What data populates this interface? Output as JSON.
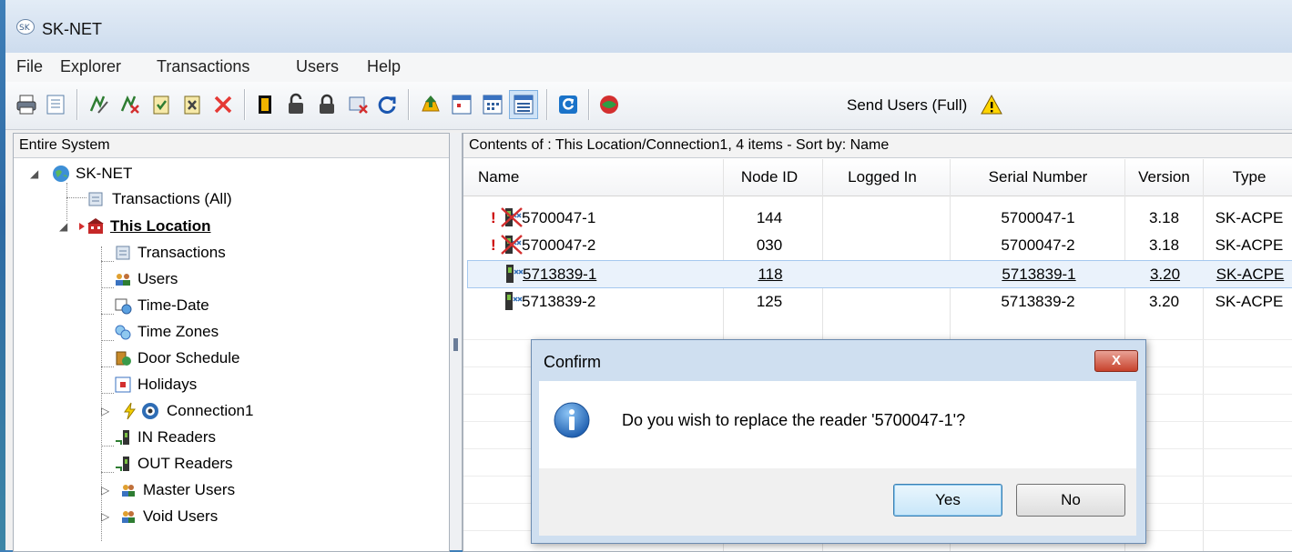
{
  "app": {
    "title": "SK-NET"
  },
  "menu": [
    "File",
    "Explorer",
    "Transactions",
    "Users",
    "Help"
  ],
  "toolbar": {
    "send_users_label": "Send Users (Full)"
  },
  "left_pane": {
    "header": "Entire System",
    "tree": {
      "root": "SK-NET",
      "transactions_all": "Transactions (All)",
      "location": "This Location",
      "items": [
        "Transactions",
        "Users",
        "Time-Date",
        "Time Zones",
        "Door Schedule",
        "Holidays",
        "Connection1",
        "IN Readers",
        "OUT Readers",
        "Master Users",
        "Void Users"
      ]
    }
  },
  "right_pane": {
    "header": "Contents of : This Location/Connection1, 4 items - Sort by: Name",
    "columns": [
      "Name",
      "Node ID",
      "Logged In",
      "Serial Number",
      "Version",
      "Type"
    ],
    "rows": [
      {
        "name": "5700047-1",
        "node_id": "144",
        "logged_in": "",
        "serial": "5700047-1",
        "version": "3.18",
        "type": "SK-ACPE",
        "flag": "!"
      },
      {
        "name": "5700047-2",
        "node_id": "030",
        "logged_in": "",
        "serial": "5700047-2",
        "version": "3.18",
        "type": "SK-ACPE",
        "flag": "!"
      },
      {
        "name": "5713839-1",
        "node_id": "118",
        "logged_in": "",
        "serial": "5713839-1",
        "version": "3.20",
        "type": "SK-ACPE",
        "flag": ""
      },
      {
        "name": "5713839-2",
        "node_id": "125",
        "logged_in": "",
        "serial": "5713839-2",
        "version": "3.20",
        "type": "SK-ACPE",
        "flag": ""
      }
    ]
  },
  "dialog": {
    "title": "Confirm",
    "message": "Do you wish to replace the reader '5700047-1'?",
    "yes": "Yes",
    "no": "No",
    "close": "X"
  },
  "colors": {
    "accent": "#3c7fb1",
    "close_red": "#c7422c",
    "selection": "#eaf2fb"
  }
}
